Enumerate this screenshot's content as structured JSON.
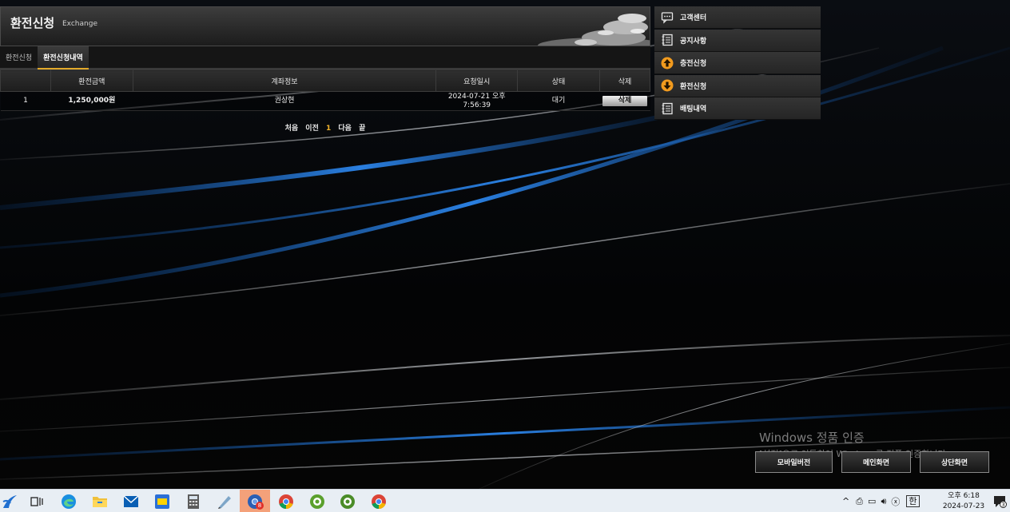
{
  "panel": {
    "title": "환전신청",
    "subtitle": "Exchange",
    "tabs": [
      {
        "label": "환전신청",
        "active": false
      },
      {
        "label": "환전신청내역",
        "active": true
      }
    ]
  },
  "table": {
    "headers": [
      "",
      "환전금액",
      "계좌정보",
      "요청일시",
      "상태",
      "삭제"
    ],
    "rows": [
      {
        "no": "1",
        "amount": "1,250,000원",
        "account": "권상현",
        "date_line1": "2024-07-21 오후",
        "date_line2": "7:56:39",
        "status": "대기",
        "delete_label": "삭제"
      }
    ]
  },
  "pager": {
    "first": "처음",
    "prev": "이전",
    "current": "1",
    "next": "다음",
    "last": "끝"
  },
  "side_menu": [
    {
      "label": "고객센터",
      "icon": "chat-icon"
    },
    {
      "label": "공지사항",
      "icon": "notepad-icon"
    },
    {
      "label": "충전신청",
      "icon": "arrow-up-circle-icon"
    },
    {
      "label": "환전신청",
      "icon": "arrow-down-circle-icon"
    },
    {
      "label": "배팅내역",
      "icon": "notepad-icon"
    }
  ],
  "watermark": {
    "line1": "Windows 정품 인증",
    "line2": "[설정]으로 이동하여 Windows를 정품 인증합니다."
  },
  "bottom_buttons": {
    "mobile": "모바일버전",
    "main": "메인화면",
    "top": "상단화면"
  },
  "taskbar": {
    "chrome_badge": "8",
    "ime": "한",
    "time": "오후 6:18",
    "date": "2024-07-23",
    "notify_count": "3"
  },
  "colors": {
    "accent": "#f1b32b",
    "taskbar": "#e8eef4",
    "menu_orange": "#f29b1e"
  }
}
